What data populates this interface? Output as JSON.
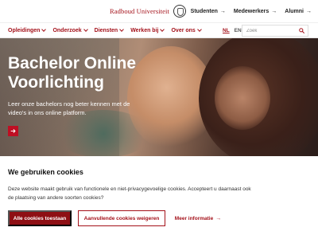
{
  "brand": {
    "name": "Radboud Universiteit"
  },
  "util_links": [
    {
      "label": "Studenten",
      "arrow": "→"
    },
    {
      "label": "Medewerkers",
      "arrow": "→"
    },
    {
      "label": "Alumni",
      "arrow": "→"
    }
  ],
  "nav": {
    "items": [
      {
        "label": "Opleidingen"
      },
      {
        "label": "Onderzoek"
      },
      {
        "label": "Diensten"
      },
      {
        "label": "Werken bij"
      },
      {
        "label": "Over ons"
      }
    ],
    "languages": {
      "active": "NL",
      "other": "EN"
    },
    "search": {
      "placeholder": "Zoek",
      "icon": "search-icon"
    }
  },
  "hero": {
    "title": "Bachelor Online Voorlichting",
    "text": "Leer onze bachelors nog beter kennen met de video's in ons online platform.",
    "button_icon": "arrow-right-icon"
  },
  "cookie": {
    "title": "We gebruiken cookies",
    "text": "Deze website maakt gebruik van functionele en niet-privacygevoelige cookies. Accepteert u daarnaast ook de plaatsing van andere soorten cookies?",
    "accept_label": "Alle cookies toestaan",
    "refuse_label": "Aanvullende cookies weigeren",
    "more_label": "Meer informatie",
    "more_arrow": "→"
  },
  "colors": {
    "brand_red": "#a4111a",
    "accent_red": "#be0f23",
    "accept_bg": "#8e0f14"
  }
}
